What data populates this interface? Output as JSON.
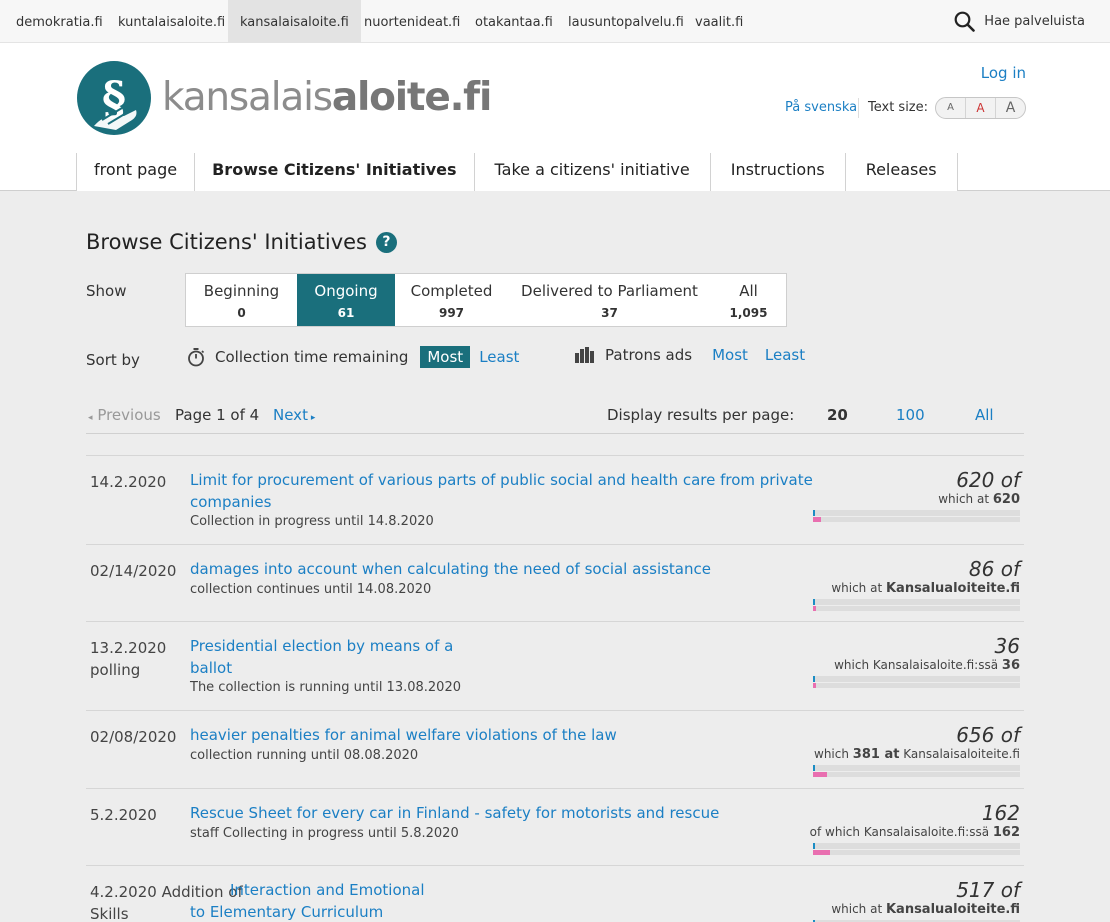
{
  "services": [
    "demokratia.fi",
    "kuntalaisaloite.fi",
    "kansalaisaloite.fi",
    "nuortenideat.fi",
    "otakantaa.fi",
    "lausuntopalvelu.fi",
    "vaalit.fi"
  ],
  "search_label": "Hae palveluista",
  "logo": {
    "part1": "kansalais",
    "part2": "aloite.fi"
  },
  "header": {
    "login": "Log in",
    "lang": "På svenska",
    "text_size": "Text size:",
    "ts_small": "A",
    "ts_mid": "A",
    "ts_big": "A"
  },
  "nav": [
    "front page",
    "Browse Citizens' Initiatives",
    "Take a citizens' initiative",
    "Instructions",
    "Releases"
  ],
  "page": {
    "title": "Browse Citizens' Initiatives",
    "help": "?"
  },
  "show": {
    "label": "Show",
    "tabs": [
      {
        "label": "Beginning",
        "count": "0"
      },
      {
        "label": "Ongoing",
        "count": "61"
      },
      {
        "label": "Completed",
        "count": "997"
      },
      {
        "label": "Delivered to Parliament",
        "count": "37"
      },
      {
        "label": "All",
        "count": "1,095"
      }
    ]
  },
  "sort": {
    "label": "Sort by",
    "time_label": "Collection time remaining",
    "most": "Most",
    "least": "Least",
    "patrons_label": "Patrons ads",
    "most2": "Most",
    "least2": "Least"
  },
  "pager": {
    "prev": "Previous",
    "info": "Page 1 of 4",
    "next": "Next",
    "per_label": "Display results per page:",
    "p20": "20",
    "p100": "100",
    "pall": "All"
  },
  "initiatives": [
    {
      "date": "14.2.2020",
      "title1": "Limit for procurement of various parts of public social and health care from private",
      "title2": "companies",
      "sub": "Collection in progress until 14.8.2020",
      "count": "620 of",
      "which_pre": "which at ",
      "which_b": "620",
      "which_post": "",
      "progress": 0.04
    },
    {
      "date": "02/14/2020",
      "title1": "damages into account when calculating the need of social assistance",
      "title2": "",
      "sub": "collection continues until 14.08.2020",
      "count": "86 of",
      "which_pre": "which at ",
      "which_b": "Kansalualoiteite.fi",
      "which_post": "",
      "progress": 0.01
    },
    {
      "date": "13.2.2020",
      "date2": "polling",
      "title1": "Presidential election by means of a",
      "title2": "ballot",
      "sub": "The collection is running until 13.08.2020",
      "count": "36",
      "which_pre": "which Kansalaisaloite.fi:ssä ",
      "which_b": "36",
      "which_post": "",
      "progress": 0.005
    },
    {
      "date": "02/08/2020",
      "title1": "heavier penalties for animal welfare violations of the law",
      "title2": "",
      "sub": "collection running until 08.08.2020",
      "count": "656 of",
      "which_pre": "which ",
      "which_b": "381 at",
      "which_post": " Kansalaisaloiteite.fi",
      "progress": 0.07
    },
    {
      "date": "5.2.2020",
      "title1": "Rescue Sheet for every car in Finland - safety for motorists and rescue",
      "title2": "",
      "sub": "staff Collecting in progress until 5.8.2020",
      "count": "162",
      "which_pre": "of which Kansalaisaloite.fi:ssä ",
      "which_b": "162",
      "which_post": "",
      "progress": 0.08
    },
    {
      "date": "4.2.2020 Addition of",
      "date2": "Skills",
      "title1": "Interaction and Emotional",
      "title2": "to Elementary Curriculum",
      "sub": "",
      "count": "517 of",
      "which_pre": "which at ",
      "which_b": "Kansalualoiteite.fi",
      "which_post": "",
      "progress": 0.05
    }
  ]
}
